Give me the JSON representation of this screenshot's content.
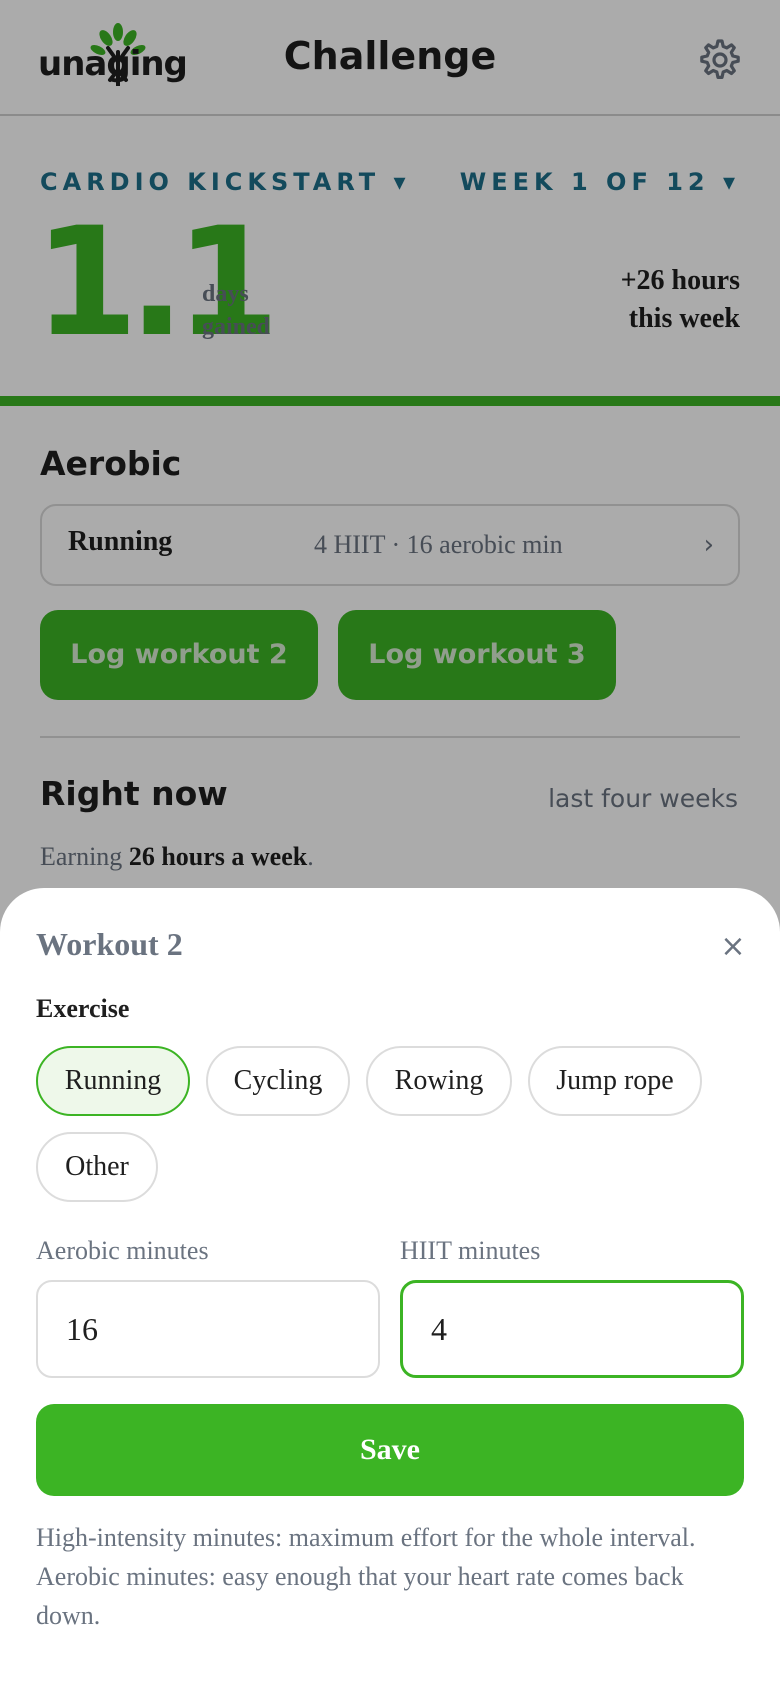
{
  "header": {
    "logo_text": "unaging",
    "title": "Challenge"
  },
  "summary": {
    "program_select": "CARDIO KICKSTART ▾",
    "week_select": "WEEK 1 OF 12 ▾",
    "days_gained": "1.1",
    "days_label_1": "days",
    "days_label_2": "gained",
    "hours_line_1": "+26 hours",
    "hours_line_2": "this week"
  },
  "aerobic": {
    "title": "Aerobic",
    "card_name": "Running",
    "card_detail": "4 HIIT · 16 aerobic min",
    "chevron": "›",
    "log_btn_2": "Log workout 2",
    "log_btn_3": "Log workout 3"
  },
  "right_now": {
    "title": "Right now",
    "range": "last four weeks",
    "earning_prefix": "Earning ",
    "earning_bold": "26 hours a week",
    "earning_suffix": "."
  },
  "sheet": {
    "title": "Workout 2",
    "close": "×",
    "exercise_label": "Exercise",
    "chips": [
      "Running",
      "Cycling",
      "Rowing",
      "Jump rope",
      "Other"
    ],
    "selected_chip": "Running",
    "aerobic_label": "Aerobic minutes",
    "aerobic_value": "16",
    "hiit_label": "HIIT minutes",
    "hiit_value": "4",
    "save": "Save",
    "help": "High-intensity minutes: maximum effort for the whole interval. Aerobic minutes: easy enough that your heart rate comes back down."
  },
  "colors": {
    "brand_green": "#3cb424",
    "link_teal": "#1d6f8a",
    "muted_text": "#6a7380"
  },
  "icons": {
    "logo": "tree-logo-icon",
    "settings": "gear-icon",
    "close": "close-icon",
    "card": "chevron-right-icon"
  }
}
